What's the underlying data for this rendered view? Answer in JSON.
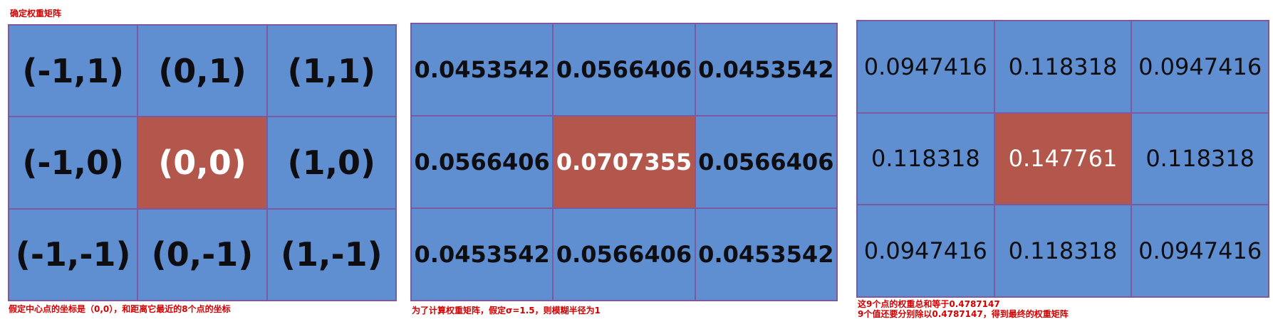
{
  "captions": {
    "title": "确定权重矩阵",
    "grid1": "假定中心点的坐标是（0,0），和距离它最近的8个点的坐标",
    "grid2": "为了计算权重矩阵，假定σ=1.5，则模糊半径为1",
    "grid3_line1": "这9个点的权重总和等于0.4787147",
    "grid3_line2": "9个值还要分别除以0.4787147，得到最终的权重矩阵"
  },
  "coordinates": [
    "(-1,1)",
    "(0,1)",
    "(1,1)",
    "(-1,0)",
    "(0,0)",
    "(1,0)",
    "(-1,-1)",
    "(0,-1)",
    "(1,-1)"
  ],
  "weights": [
    "0.0453542",
    "0.0566406",
    "0.0453542",
    "0.0566406",
    "0.0707355",
    "0.0566406",
    "0.0453542",
    "0.0566406",
    "0.0453542"
  ],
  "normalized_weights": [
    "0.0947416",
    "0.118318",
    "0.0947416",
    "0.118318",
    "0.147761",
    "0.118318",
    "0.0947416",
    "0.118318",
    "0.0947416"
  ],
  "colors": {
    "cell": "#5f8fd1",
    "center_cell": "#b3564c",
    "grid_line": "#7b5aa0",
    "caption": "#d40000"
  }
}
